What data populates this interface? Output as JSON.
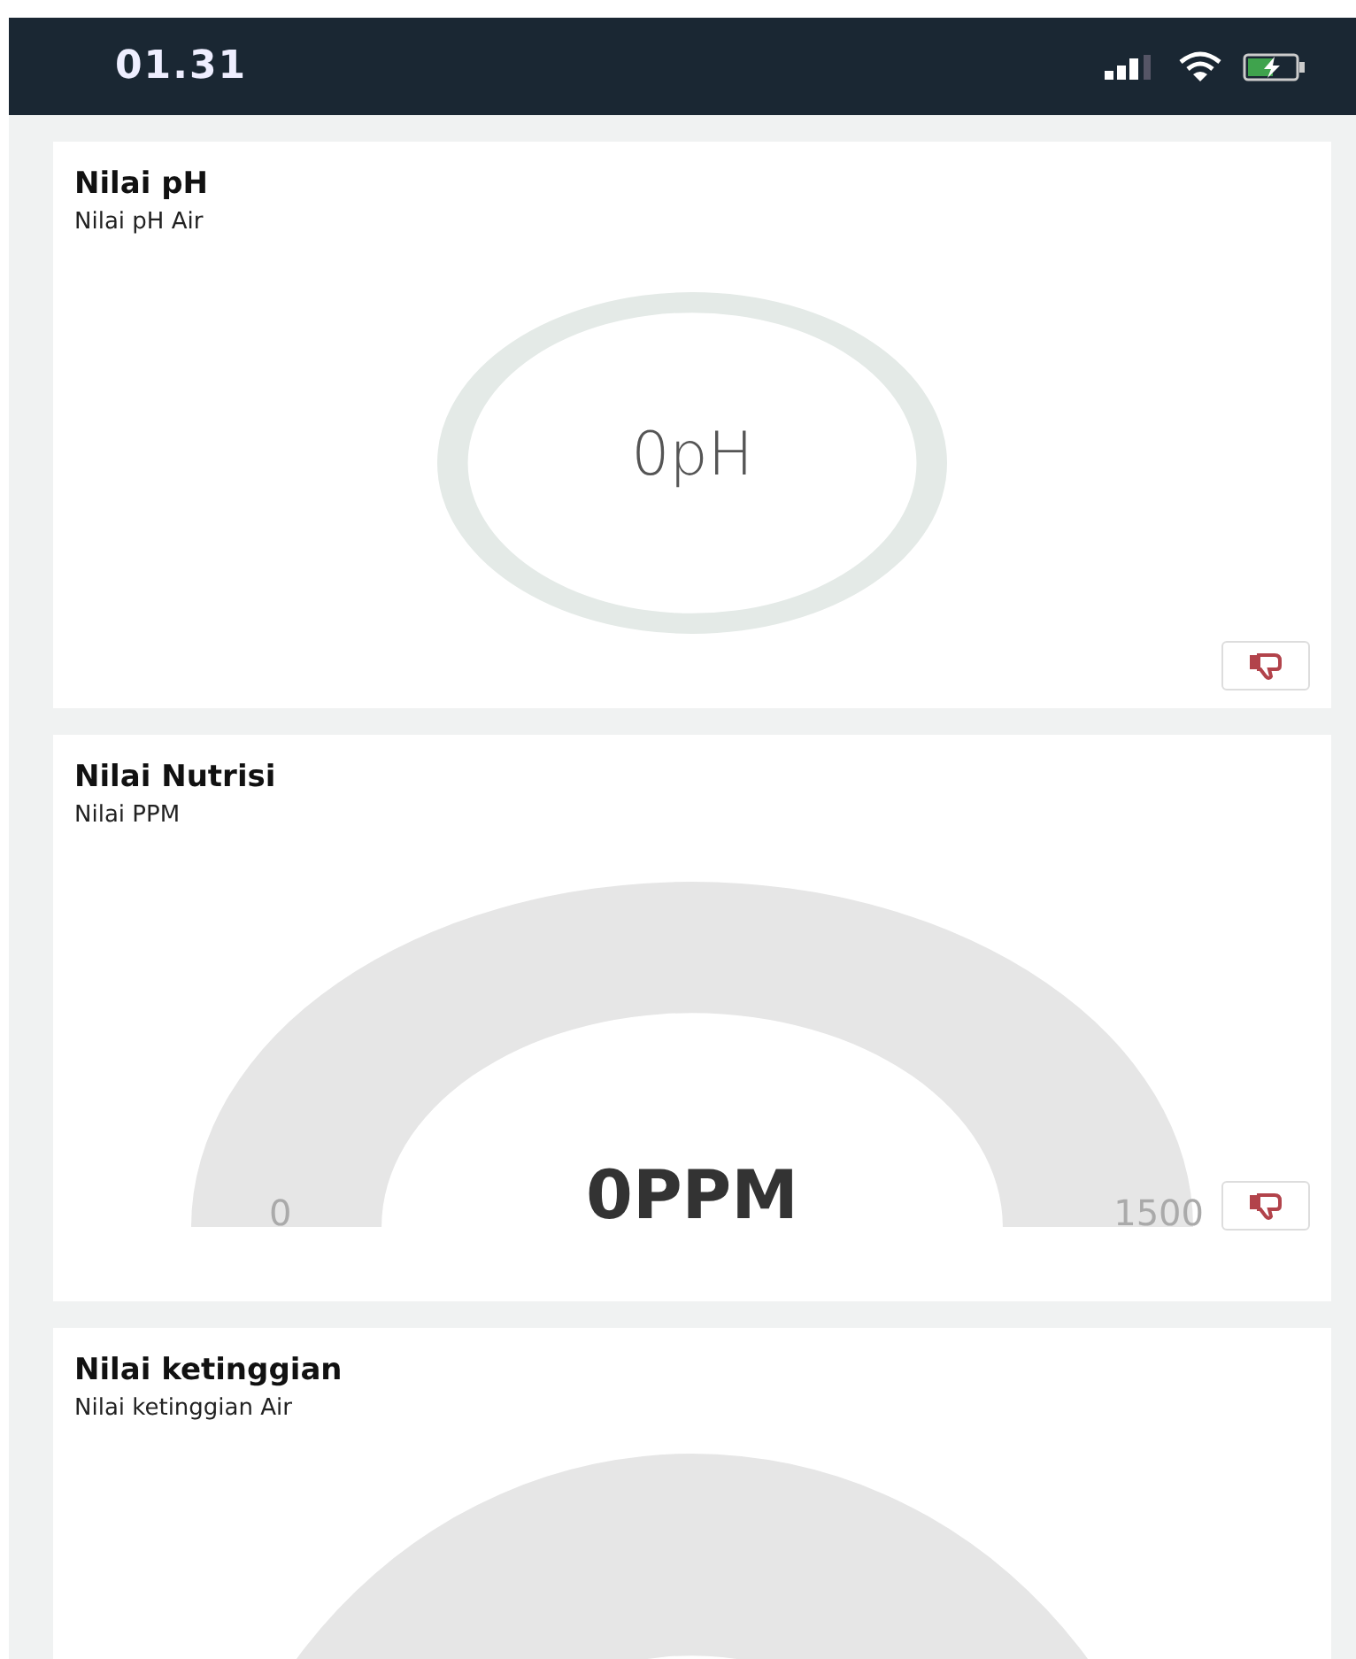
{
  "status_bar": {
    "time": "01.31"
  },
  "cards": [
    {
      "kind": "ring",
      "title": "Nilai pH",
      "subtitle": "Nilai pH Air",
      "value": "0pH"
    },
    {
      "kind": "semi",
      "title": "Nilai Nutrisi",
      "subtitle": "Nilai PPM",
      "value": "0PPM",
      "min": "0",
      "max": "1500"
    },
    {
      "kind": "semi-cut",
      "title": "Nilai ketinggian",
      "subtitle": "Nilai ketinggian Air"
    }
  ]
}
